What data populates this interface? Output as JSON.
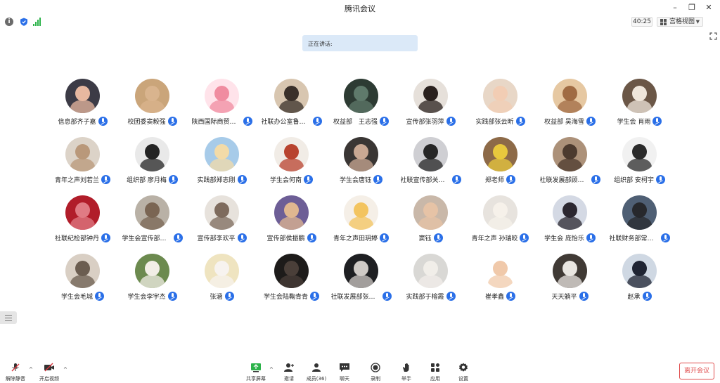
{
  "window": {
    "title": "腾讯会议",
    "controls": [
      "minimize",
      "restore",
      "close"
    ]
  },
  "status_bar": {
    "timer": "40:25",
    "view_mode_label": "宫格视图",
    "icons": [
      "info-icon",
      "shield-icon",
      "signal-icon",
      "fullscreen-icon"
    ]
  },
  "speaking": {
    "label": "正在讲话:"
  },
  "participants": [
    {
      "name": "信息部齐子嘉",
      "bg": "#3c3b46",
      "face": "#e7b8a0"
    },
    {
      "name": "校团委窦毅强",
      "bg": "#caa57a",
      "face": "#d9b48e"
    },
    {
      "name": "陕西国际商贸学...",
      "bg": "#ffe3ea",
      "face": "#f08ca0"
    },
    {
      "name": "社联办公室鲁英英",
      "bg": "#d8c6b0",
      "face": "#3a302a"
    },
    {
      "name": "权益部　王志强",
      "bg": "#2d3b33",
      "face": "#5f7a6b"
    },
    {
      "name": "宣传部张羽萍",
      "bg": "#e6e0da",
      "face": "#2a211e"
    },
    {
      "name": "实践部张云昕",
      "bg": "#e8d7c7",
      "face": "#f2cdb4"
    },
    {
      "name": "权益部 吴海雪",
      "bg": "#e6c8a2",
      "face": "#a06b43"
    },
    {
      "name": "学生会 肖雨",
      "bg": "#6b5747",
      "face": "#efe6db"
    },
    {
      "name": "青年之声刘若兰",
      "bg": "#dcd3c8",
      "face": "#b9987a"
    },
    {
      "name": "组织部 廖月梅",
      "bg": "#e9e9e9",
      "face": "#242424"
    },
    {
      "name": "实践部郑志刚",
      "bg": "#a7cbe9",
      "face": "#f3dba8"
    },
    {
      "name": "学生会何南",
      "bg": "#f1ece6",
      "face": "#b8432f"
    },
    {
      "name": "学生会唐钰",
      "bg": "#3a3634",
      "face": "#c9a893"
    },
    {
      "name": "社联宣传部关小峰",
      "bg": "#cfcfd3",
      "face": "#262626"
    },
    {
      "name": "郑老师",
      "bg": "#8d6a48",
      "face": "#e8c83d"
    },
    {
      "name": "社联发展部顾千迪",
      "bg": "#ac9179",
      "face": "#4c3a2e"
    },
    {
      "name": "组织部 安柯宇",
      "bg": "#f1f1f1",
      "face": "#2b2b2b"
    },
    {
      "name": "社联纪检部钟丹",
      "bg": "#b11d2a",
      "face": "#e07b84"
    },
    {
      "name": "学生会宣传部刘...",
      "bg": "#b9b1a6",
      "face": "#7a6553"
    },
    {
      "name": "宣传部李欢平",
      "bg": "#e7e2dc",
      "face": "#7e6b5d"
    },
    {
      "name": "宣传部侯振鹏",
      "bg": "#6d5e96",
      "face": "#e0b790"
    },
    {
      "name": "青年之声田玥婷",
      "bg": "#f5efe7",
      "face": "#f3c45f"
    },
    {
      "name": "窦钰",
      "bg": "#c9b8a9",
      "face": "#e6c3a6"
    },
    {
      "name": "青年之声 孙瑞皎",
      "bg": "#e7e3de",
      "face": "#f6f1ea"
    },
    {
      "name": "学生会 庞怡乐",
      "bg": "#d4d9e4",
      "face": "#2b2730"
    },
    {
      "name": "社联财务部常佳欣",
      "bg": "#4f5f74",
      "face": "#27282c"
    },
    {
      "name": "学生会毛城",
      "bg": "#d9cfc4",
      "face": "#6b5d50"
    },
    {
      "name": "学生会李宇杰",
      "bg": "#6c8a4f",
      "face": "#f2eee6"
    },
    {
      "name": "张涵",
      "bg": "#efe4c0",
      "face": "#f7f3ef"
    },
    {
      "name": "学生会陆鞠青青",
      "bg": "#1d1b1a",
      "face": "#4a3f39"
    },
    {
      "name": "社联发展部张博文",
      "bg": "#1e1f22",
      "face": "#cfcac6"
    },
    {
      "name": "实践部于榕霞",
      "bg": "#d9d8d5",
      "face": "#f1eee9"
    },
    {
      "name": "崔孝鑫",
      "bg": "#ffffff",
      "face": "#f0c9aa"
    },
    {
      "name": "天天躺平",
      "bg": "#403a35",
      "face": "#e9e6e1"
    },
    {
      "name": "赵承",
      "bg": "#cfd8e3",
      "face": "#1f2433"
    }
  ],
  "toolbar": {
    "mute_label": "解除静音",
    "video_label": "开启视频",
    "share_label": "共享屏幕",
    "invite_label": "邀请",
    "members_label": "成员(36)",
    "chat_label": "聊天",
    "record_label": "录制",
    "raise_hand_label": "举手",
    "apps_label": "应用",
    "settings_label": "设置",
    "leave_label": "离开会议"
  },
  "colors": {
    "accent": "#2a6fe8",
    "leave": "#e04b4b",
    "speaking_bg": "#dbe9f8",
    "signal": "#2cb34a",
    "muted_red": "#d9363e"
  }
}
